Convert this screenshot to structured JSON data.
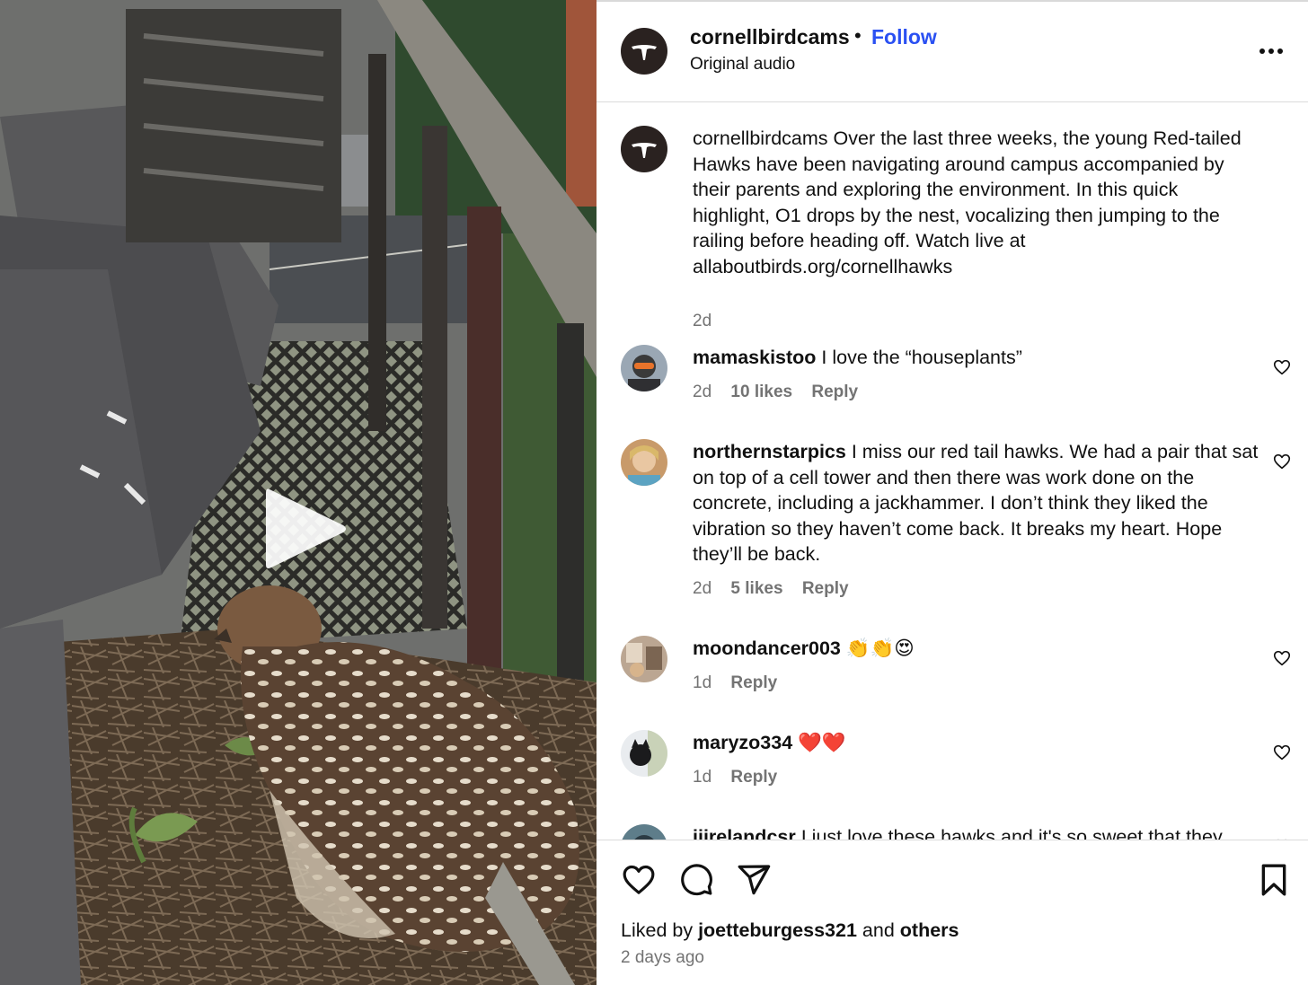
{
  "post": {
    "username": "cornellbirdcams",
    "separator": "•",
    "follow_label": "Follow",
    "audio_label": "Original audio",
    "caption": "Over the last three weeks, the young Red-tailed Hawks have been navigating around campus accompanied by their parents and exploring the environment. In this quick highlight, O1 drops by the nest, vocalizing then jumping to the railing before heading off. Watch live at allaboutbirds.org/cornellhawks",
    "caption_time": "2d"
  },
  "comments": [
    {
      "username": "mamaskistoo",
      "text": "I love the “houseplants”",
      "time": "2d",
      "likes": "10 likes",
      "reply": "Reply"
    },
    {
      "username": "northernstarpics",
      "text": "I miss our red tail hawks. We had a pair that sat on top of a cell tower and then there was work done on the concrete, including a jackhammer. I don’t think they liked the vibration so they haven’t come back. It breaks my heart. Hope they’ll be back.",
      "time": "2d",
      "likes": "5 likes",
      "reply": "Reply"
    },
    {
      "username": "moondancer003",
      "text": "👏👏😍",
      "time": "1d",
      "reply": "Reply"
    },
    {
      "username": "maryzo334",
      "text": "❤️❤️",
      "time": "1d",
      "reply": "Reply"
    },
    {
      "username": "jjirelandcsr",
      "text": "I just love these hawks and it's so sweet that they"
    }
  ],
  "footer": {
    "liked_by_prefix": "Liked by",
    "liked_by_user": "joetteburgess321",
    "liked_by_and": "and",
    "liked_by_others": "others",
    "post_time": "2 days ago"
  },
  "icons": {
    "play": "play-icon",
    "more": "more-options-icon",
    "like": "heart-icon",
    "comment": "comment-icon",
    "share": "send-icon",
    "save": "bookmark-icon"
  },
  "colors": {
    "follow": "#2a50f2",
    "muted_text": "#737373",
    "divider": "#dbdbdb"
  }
}
